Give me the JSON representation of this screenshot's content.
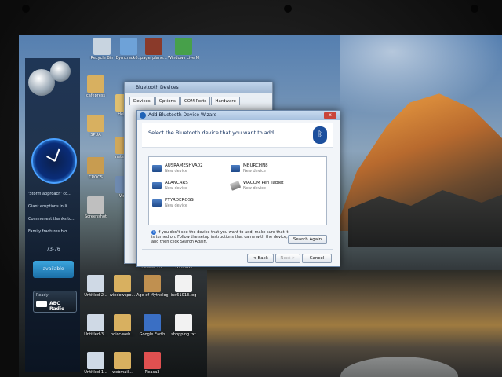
{
  "sidebar": {
    "feed_items": [
      "'Storm approach' co...",
      "Giant eruptions in li...",
      "Commonest thanks to...",
      "Family fractures blo..."
    ],
    "feed_nav": "73-76",
    "status_button": "available",
    "radio": {
      "label_top": "Ready",
      "station": "ABC Radio"
    }
  },
  "desktop_icons": [
    {
      "label": "Recycle Bin",
      "color": "#c8d4e0"
    },
    {
      "label": "Bymcrack6...",
      "color": "#6ea2d8"
    },
    {
      "label": "page_plane...",
      "color": "#8a3a2a"
    },
    {
      "label": "Windows Live Mess...",
      "color": "#47a04a"
    },
    {
      "label": "cafepress",
      "color": "#d8b060"
    },
    {
      "label": "HeD...",
      "color": "#e0c070"
    },
    {
      "label": "SPUA",
      "color": "#d8b060"
    },
    {
      "label": "netsoft...",
      "color": "#d0a85a"
    },
    {
      "label": "CROCS",
      "color": "#c89c50"
    },
    {
      "label": "Vista",
      "color": "#6e8ab0"
    },
    {
      "label": "Screenshot",
      "color": "#bfbfbf"
    },
    {
      "label": "Reader 7.0",
      "color": "#b03030"
    },
    {
      "label": "Windows",
      "color": "#6e8ab0"
    },
    {
      "label": "Untitled-2...",
      "color": "#cfd9e5"
    },
    {
      "label": "windowspo...",
      "color": "#d8b060"
    },
    {
      "label": "Age of Mythology",
      "color": "#c09050"
    },
    {
      "label": "ind61013.log",
      "color": "#f2f2f2"
    },
    {
      "label": "Untitled-3...",
      "color": "#cfd9e5"
    },
    {
      "label": "noicc-web...",
      "color": "#d8b060"
    },
    {
      "label": "Google Earth",
      "color": "#3a6fc4"
    },
    {
      "label": "shopping.txt",
      "color": "#f2f2f2"
    },
    {
      "label": "Untitled-1...",
      "color": "#cfd9e5"
    },
    {
      "label": "webmail...",
      "color": "#d8b060"
    },
    {
      "label": "Picasa3",
      "color": "#e05050"
    }
  ],
  "bt_devices_window": {
    "title": "Bluetooth Devices",
    "tabs": [
      "Devices",
      "Options",
      "COM Ports",
      "Hardware"
    ]
  },
  "wizard": {
    "title": "Add Bluetooth Device Wizard",
    "close": "x",
    "heading": "Select the Bluetooth device that you want to add.",
    "bt_glyph": "ᛒ",
    "devices": [
      {
        "name": "AUSRAMESHVA02",
        "status": "New device"
      },
      {
        "name": "MBURCHN8",
        "status": "New device"
      },
      {
        "name": "ALANCARS",
        "status": "New device"
      },
      {
        "name": "WACOM Pen Tablet",
        "status": "New device"
      },
      {
        "name": "PTYRDEROSS",
        "status": "New device"
      }
    ],
    "info_icon": "i",
    "info_text": "If you don't see the device that you want to add, make sure that it is turned on. Follow the setup instructions that came with the device, and then click Search Again.",
    "search_again": "Search Again",
    "back": "< Back",
    "next": "Next >",
    "cancel": "Cancel"
  }
}
